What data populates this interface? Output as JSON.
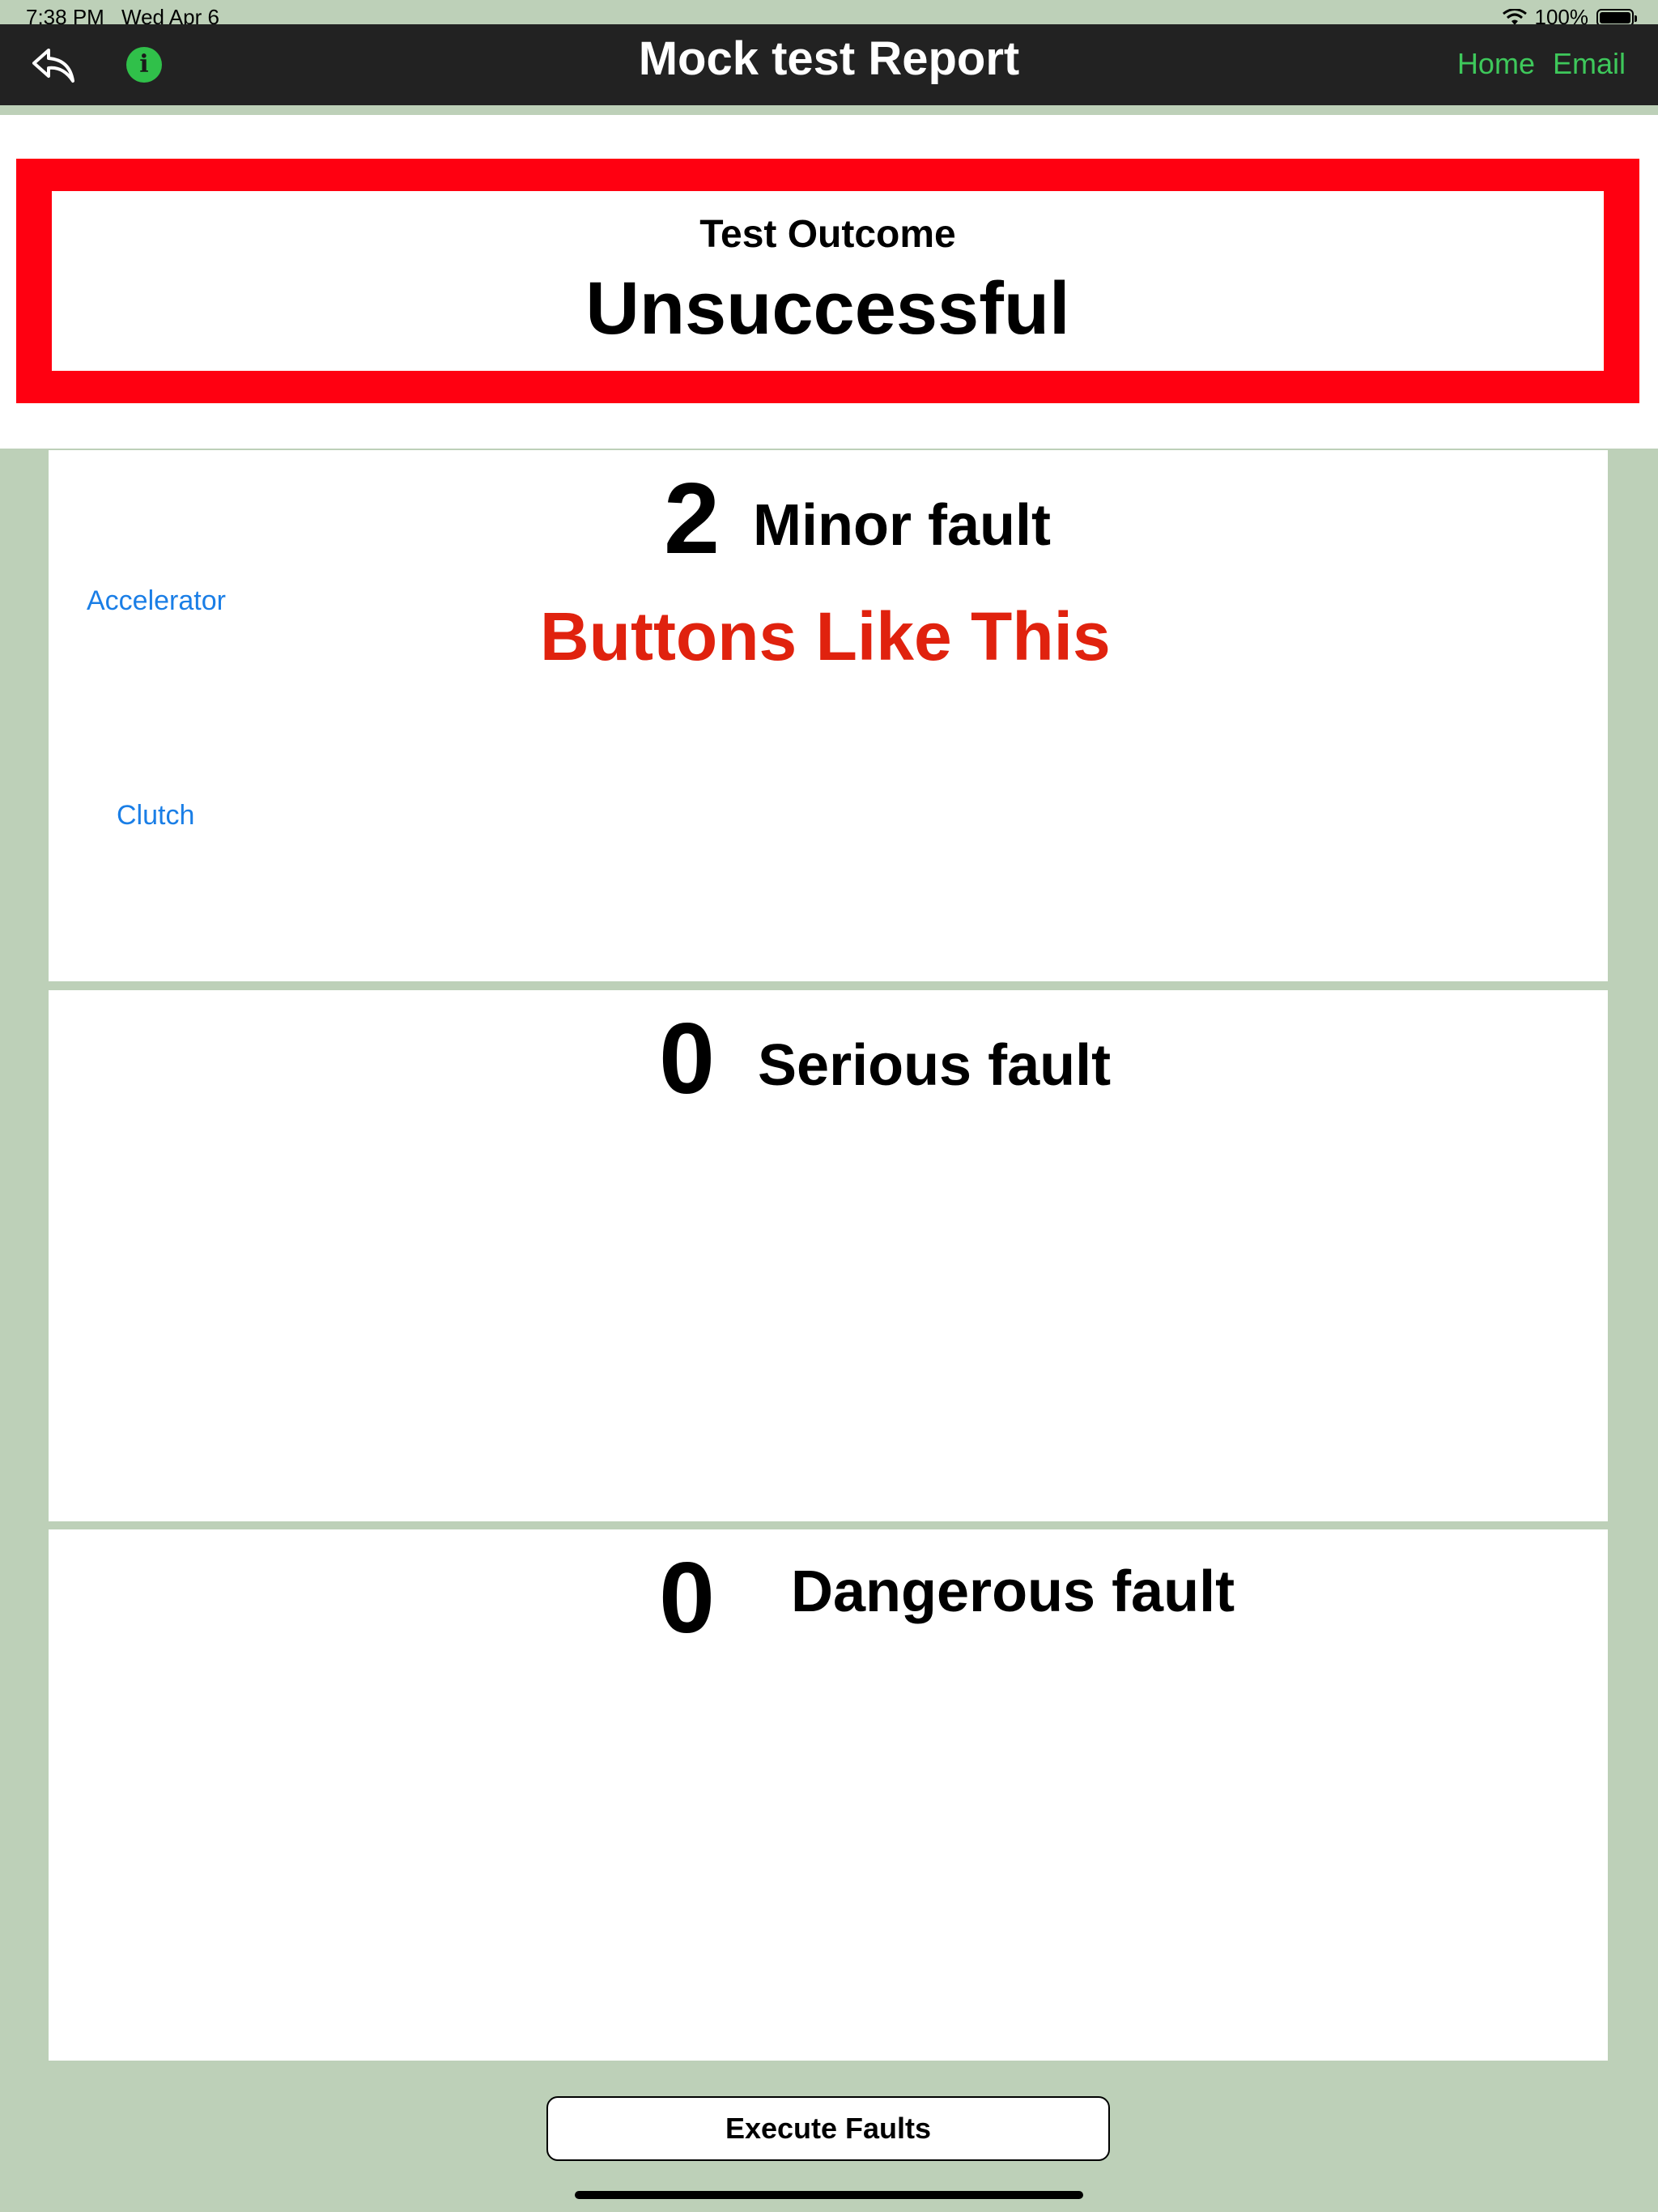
{
  "status_bar": {
    "time": "7:38 PM",
    "date": "Wed Apr 6",
    "battery": "100%"
  },
  "nav": {
    "title": "Mock test Report",
    "home_label": "Home",
    "email_label": "Email"
  },
  "outcome": {
    "label": "Test Outcome",
    "value": "Unsuccessful"
  },
  "faults": {
    "minor": {
      "count": "2",
      "label": "Minor fault",
      "items": [
        "Accelerator",
        "Clutch"
      ],
      "note": "Buttons Like This"
    },
    "serious": {
      "count": "0",
      "label": "Serious fault"
    },
    "dangerous": {
      "count": "0",
      "label": "Dangerous fault"
    }
  },
  "execute_label": "Execute  Faults",
  "colors": {
    "accent_green": "#3ec85b",
    "outcome_red": "#ff0011",
    "link_blue": "#1a7ee6",
    "note_red": "#e0220e",
    "background": "#bdd0b8"
  },
  "icons": {
    "back": "reply-arrow-icon",
    "info": "info-icon",
    "wifi": "wifi-icon",
    "battery": "battery-icon"
  }
}
